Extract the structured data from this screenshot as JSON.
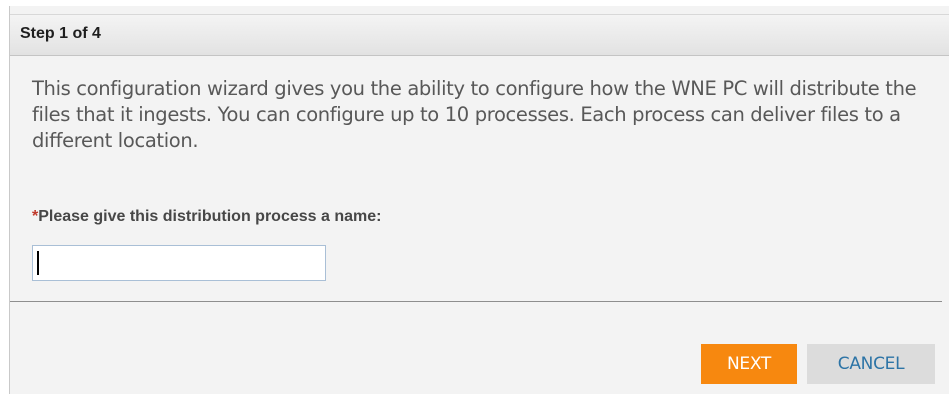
{
  "header": {
    "step_label": "Step 1 of 4"
  },
  "description": "This configuration wizard gives you the ability to configure how the WNE PC will distribute the files that it ingests. You can configure up to 10 processes. Each process can deliver files to a different location.",
  "form": {
    "name_label_required_mark": "*",
    "name_label": "Please give this distribution process a name:",
    "name_value": ""
  },
  "buttons": {
    "next_label": "NEXT",
    "cancel_label": "CANCEL"
  },
  "colors": {
    "next_bg": "#f7880f",
    "cancel_bg": "#dcdcdc",
    "cancel_text": "#2d74a6",
    "required": "#c0392b"
  }
}
